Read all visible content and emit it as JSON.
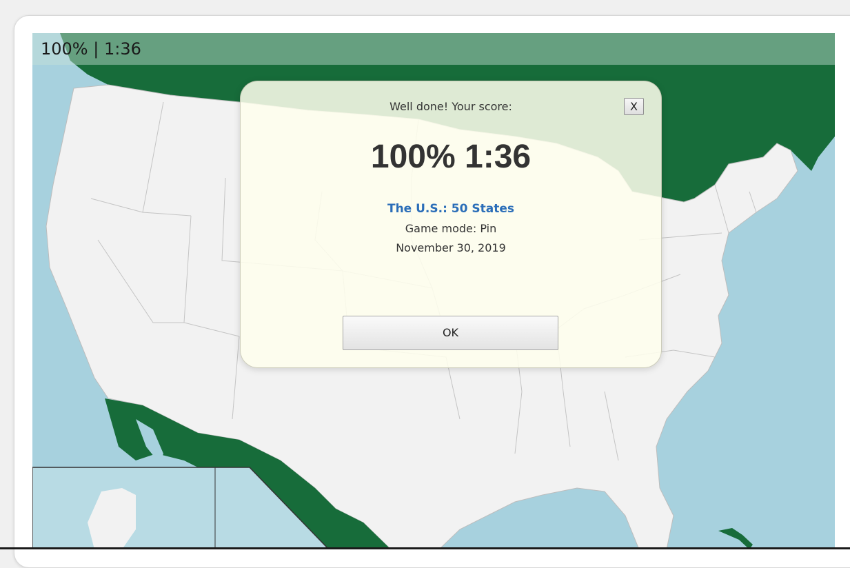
{
  "status": {
    "text": "100% | 1:36"
  },
  "modal": {
    "heading": "Well done! Your score:",
    "close_label": "X",
    "score": "100% 1:36",
    "quiz_title": "The U.S.: 50 States",
    "game_mode": "Game mode: Pin",
    "date": "November 30, 2019",
    "ok_label": "OK"
  },
  "colors": {
    "ocean": "#a7d1de",
    "land": "#f2f2f2",
    "neighbor_countries": "#176c3a",
    "modal_background": "#fffff0",
    "link": "#2a6db8"
  }
}
